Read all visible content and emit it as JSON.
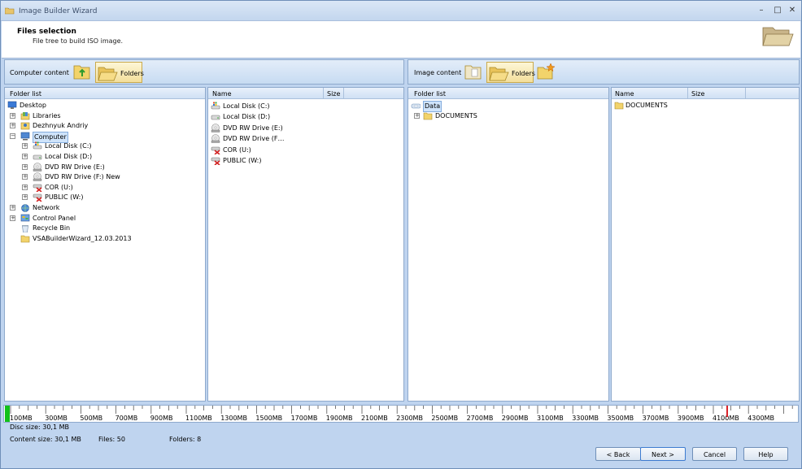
{
  "window": {
    "title": "Image Builder Wizard",
    "controls": [
      "–",
      "□",
      "✕"
    ]
  },
  "header": {
    "title": "Files selection",
    "subtitle": "File tree to build ISO image."
  },
  "left_toolbar": {
    "label": "Computer content",
    "folders_label": "Folders"
  },
  "right_toolbar": {
    "label": "Image content",
    "folders_label": "Folders"
  },
  "left_tree": {
    "header": "Folder list",
    "items": [
      {
        "label": "Desktop",
        "icon": "desktop-icon"
      },
      {
        "label": "Libraries",
        "icon": "libraries-icon"
      },
      {
        "label": "Dezhnyuk Andriy",
        "icon": "user-folder-icon"
      },
      {
        "label": "Computer",
        "icon": "computer-icon"
      },
      {
        "label": "Local Disk (C:)",
        "icon": "windows-disk-icon"
      },
      {
        "label": "Local Disk (D:)",
        "icon": "disk-icon"
      },
      {
        "label": "DVD RW Drive (E:)",
        "icon": "dvd-drive-icon"
      },
      {
        "label": "DVD RW Drive (F:) New",
        "icon": "dvd-drive-icon"
      },
      {
        "label": "COR (U:)",
        "icon": "network-drive-disconnected-icon"
      },
      {
        "label": "PUBLIC (W:)",
        "icon": "network-drive-disconnected-icon"
      },
      {
        "label": "Network",
        "icon": "network-icon"
      },
      {
        "label": "Control Panel",
        "icon": "control-panel-icon"
      },
      {
        "label": "Recycle Bin",
        "icon": "recycle-bin-icon"
      },
      {
        "label": "VSABuilderWizard_12.03.2013",
        "icon": "folder-icon"
      }
    ]
  },
  "left_list": {
    "col_name": "Name",
    "col_size": "Size",
    "items": [
      {
        "name": "Local Disk (C:)",
        "icon": "windows-disk-icon"
      },
      {
        "name": "Local Disk (D:)",
        "icon": "disk-icon"
      },
      {
        "name": "DVD RW Drive (E:)",
        "icon": "dvd-drive-icon"
      },
      {
        "name": "DVD RW Drive (F…",
        "icon": "dvd-drive-icon"
      },
      {
        "name": "COR (U:)",
        "icon": "network-drive-disconnected-icon"
      },
      {
        "name": "PUBLIC (W:)",
        "icon": "network-drive-disconnected-icon"
      }
    ]
  },
  "right_tree": {
    "header": "Folder list",
    "items": [
      {
        "label": "Data",
        "icon": "disc-icon"
      },
      {
        "label": "DOCUMENTS",
        "icon": "folder-icon"
      }
    ]
  },
  "right_list": {
    "col_name": "Name",
    "col_size": "Size",
    "items": [
      {
        "name": "DOCUMENTS",
        "icon": "folder-icon"
      }
    ]
  },
  "ruler": {
    "labels": [
      "100MB",
      "300MB",
      "500MB",
      "700MB",
      "900MB",
      "1100MB",
      "1300MB",
      "1500MB",
      "1700MB",
      "1900MB",
      "2100MB",
      "2300MB",
      "2500MB",
      "2700MB",
      "2900MB",
      "3100MB",
      "3300MB",
      "3500MB",
      "3700MB",
      "3900MB",
      "4100MB",
      "4300MB"
    ],
    "fill_color": "#11c11a",
    "limit_marker_color": "#d9232a"
  },
  "status": {
    "disc_size": "Disc size: 30,1 MB",
    "content_size": "Content size: 30,1 MB",
    "files": "Files: 50",
    "folders": "Folders: 8"
  },
  "buttons": {
    "back": "< Back",
    "next": "Next >",
    "cancel": "Cancel",
    "help": "Help"
  }
}
